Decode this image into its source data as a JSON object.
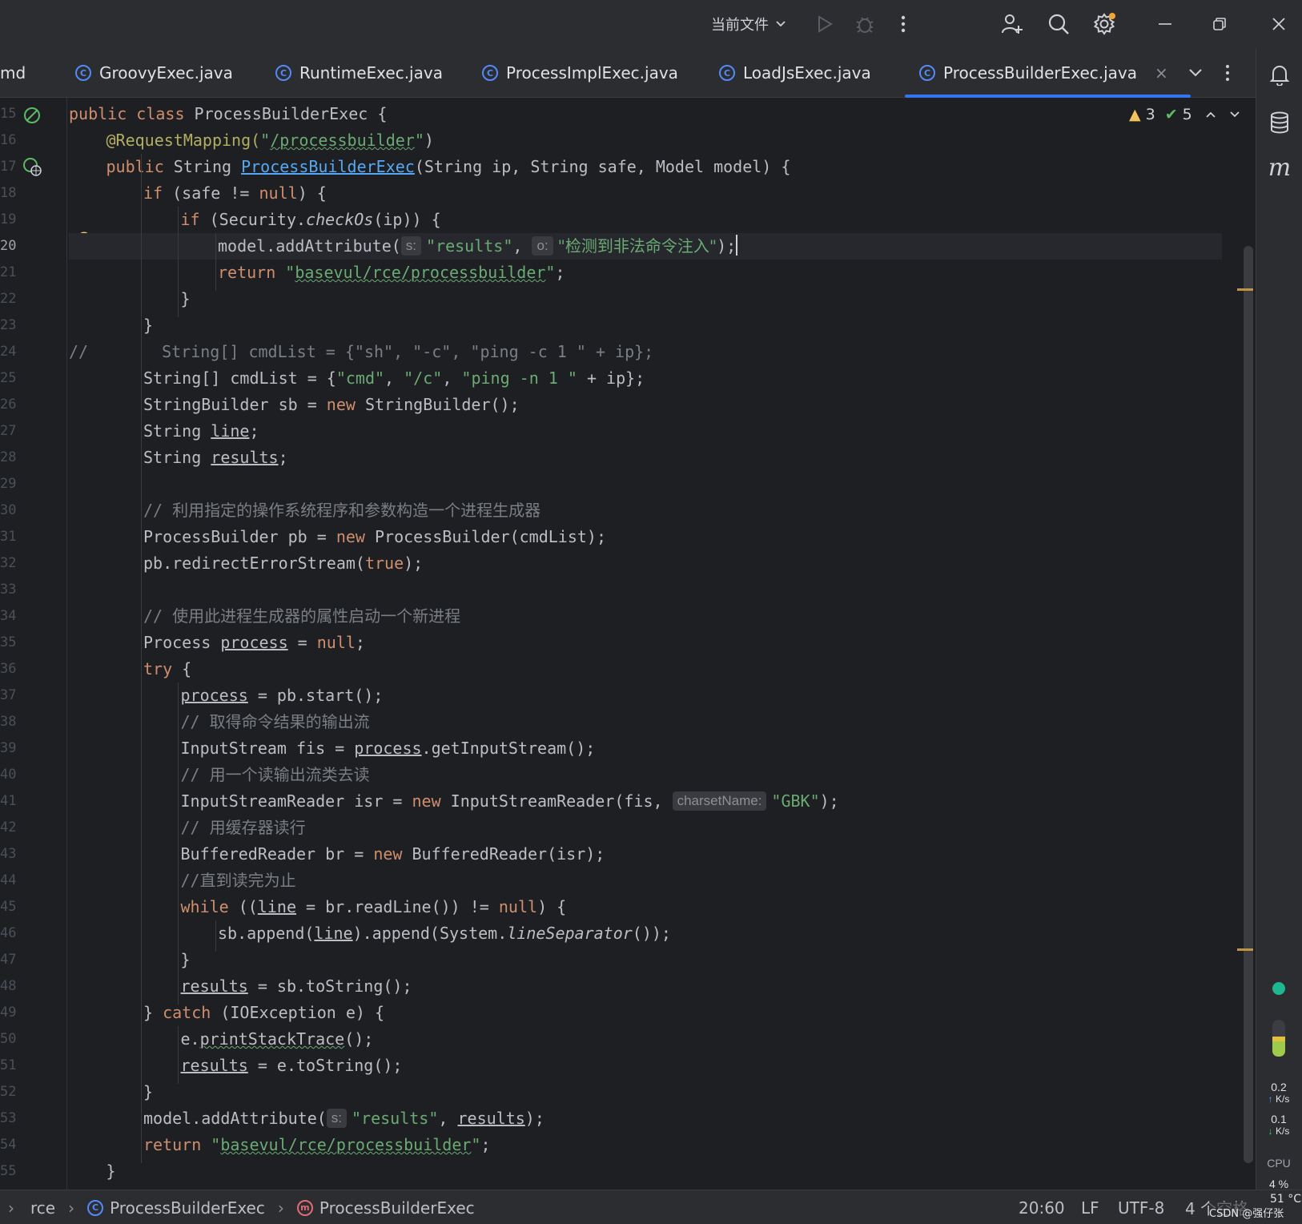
{
  "titlebar": {
    "run_config": "当前文件",
    "icons": [
      "chevron-down-icon",
      "run-icon",
      "debug-icon",
      "more-icon",
      "add-user-icon",
      "search-icon",
      "settings-icon",
      "minimize-icon",
      "restore-icon",
      "close-icon"
    ]
  },
  "tabs": [
    {
      "label": "md",
      "active": false
    },
    {
      "label": "GroovyExec.java",
      "active": false
    },
    {
      "label": "RuntimeExec.java",
      "active": false
    },
    {
      "label": "ProcessImplExec.java",
      "active": false
    },
    {
      "label": "LoadJsExec.java",
      "active": false
    },
    {
      "label": "ProcessBuilderExec.java",
      "active": true
    }
  ],
  "editor": {
    "inspections": {
      "warnings": "3",
      "ok": "5"
    },
    "current_line": "20",
    "lines": [
      {
        "n": "15"
      },
      {
        "n": "16"
      },
      {
        "n": "17"
      },
      {
        "n": "18"
      },
      {
        "n": "19"
      },
      {
        "n": "20"
      },
      {
        "n": "21"
      },
      {
        "n": "22"
      },
      {
        "n": "23"
      },
      {
        "n": "24"
      },
      {
        "n": "25"
      },
      {
        "n": "26"
      },
      {
        "n": "27"
      },
      {
        "n": "28"
      },
      {
        "n": "29"
      },
      {
        "n": "30"
      },
      {
        "n": "31"
      },
      {
        "n": "32"
      },
      {
        "n": "33"
      },
      {
        "n": "34"
      },
      {
        "n": "35"
      },
      {
        "n": "36"
      },
      {
        "n": "37"
      },
      {
        "n": "38"
      },
      {
        "n": "39"
      },
      {
        "n": "40"
      },
      {
        "n": "41"
      },
      {
        "n": "42"
      },
      {
        "n": "43"
      },
      {
        "n": "44"
      },
      {
        "n": "45"
      },
      {
        "n": "46"
      },
      {
        "n": "47"
      },
      {
        "n": "48"
      },
      {
        "n": "49"
      },
      {
        "n": "50"
      },
      {
        "n": "51"
      },
      {
        "n": "52"
      },
      {
        "n": "53"
      },
      {
        "n": "54"
      },
      {
        "n": "55"
      }
    ],
    "code": {
      "l15": [
        "public",
        " ",
        "class",
        " ProcessBuilderExec {"
      ],
      "l16": [
        "@RequestMapping(",
        "\"",
        "/processbuilder",
        "\"",
        ")"
      ],
      "l17": [
        "public",
        " String ",
        "ProcessBuilderExec",
        "(String ip, String safe, Model model) {"
      ],
      "l18": [
        "if",
        " (safe != ",
        "null",
        ") {"
      ],
      "l19": [
        "if",
        " (Security.",
        "checkOs",
        "(ip)) {"
      ],
      "l20": [
        "model.addAttribute(",
        "s:",
        "\"results\"",
        ", ",
        "o:",
        "\"检测到非法命令注入\"",
        ");"
      ],
      "l21": [
        "return",
        " ",
        "\"",
        "basevul/rce/processbuilder",
        "\"",
        ";"
      ],
      "l22": [
        "}"
      ],
      "l23": [
        "}"
      ],
      "l24": [
        "//",
        "String[] cmdList = {\"sh\", \"-c\", \"ping -c 1 \" + ip};"
      ],
      "l25": [
        "String[] cmdList = {",
        "\"cmd\"",
        ", ",
        "\"/c\"",
        ", ",
        "\"ping -n 1 \"",
        " + ip};"
      ],
      "l26": [
        "StringBuilder sb = ",
        "new",
        " StringBuilder();"
      ],
      "l27": [
        "String ",
        "line",
        ";"
      ],
      "l28": [
        "String ",
        "results",
        ";"
      ],
      "l30": [
        "// ",
        "利用指定的操作系统程序和参数构造一个进程生成器"
      ],
      "l31": [
        "ProcessBuilder pb = ",
        "new",
        " ProcessBuilder(cmdList);"
      ],
      "l32": [
        "pb.redirectErrorStream(",
        "true",
        ");"
      ],
      "l34": [
        "// ",
        "使用此进程生成器的属性启动一个新进程"
      ],
      "l35": [
        "Process ",
        "process",
        " = ",
        "null",
        ";"
      ],
      "l36": [
        "try",
        " {"
      ],
      "l37": [
        "process",
        " = pb.start();"
      ],
      "l38": [
        "// ",
        "取得命令结果的输出流"
      ],
      "l39": [
        "InputStream fis = ",
        "process",
        ".getInputStream();"
      ],
      "l40": [
        "// ",
        "用一个读输出流类去读"
      ],
      "l41": [
        "InputStreamReader isr = ",
        "new",
        " InputStreamReader(fis, ",
        "charsetName:",
        "\"GBK\"",
        ");"
      ],
      "l42": [
        "// ",
        "用缓存器读行"
      ],
      "l43": [
        "BufferedReader br = ",
        "new",
        " BufferedReader(isr);"
      ],
      "l44": [
        "//",
        "直到读完为止"
      ],
      "l45": [
        "while",
        " ((",
        "line",
        " = br.readLine()) != ",
        "null",
        ") {"
      ],
      "l46": [
        "sb.append(",
        "line",
        ").append(System.",
        "lineSeparator",
        "());"
      ],
      "l47": [
        "}"
      ],
      "l48": [
        "results",
        " = sb.toString();"
      ],
      "l49": [
        "} ",
        "catch",
        " (IOException e) {"
      ],
      "l50": [
        "e.",
        "printStackTrace",
        "();"
      ],
      "l51": [
        "results",
        " = e.toString();"
      ],
      "l52": [
        "}"
      ],
      "l53": [
        "model.addAttribute(",
        "s:",
        "\"results\"",
        ", ",
        "results",
        ");"
      ],
      "l54": [
        "return",
        " ",
        "\"",
        "basevul/rce/processbuilder",
        "\"",
        ";"
      ],
      "l55": [
        "}"
      ]
    }
  },
  "rightstrip": {
    "icons": [
      "notifications-icon",
      "database-icon",
      "maven-icon"
    ],
    "net_up": "0.2",
    "net_up_unit": "K/s",
    "net_down": "0.1",
    "net_down_unit": "K/s",
    "cpu_label": "CPU",
    "cpu_value": "4 %",
    "temp": "51 °C"
  },
  "statusbar": {
    "breadcrumb": [
      "rce",
      "ProcessBuilderExec",
      "ProcessBuilderExec"
    ],
    "position": "20:60",
    "line_sep": "LF",
    "encoding": "UTF-8",
    "indent": "4 个空格",
    "watermark": "CSDN @强仔张"
  },
  "colors": {
    "keyword": "#cf8e6d",
    "string": "#6aab73",
    "method": "#56a8f5",
    "annotation": "#b3ae60",
    "comment": "#7a7e85",
    "accent": "#3574f0"
  }
}
